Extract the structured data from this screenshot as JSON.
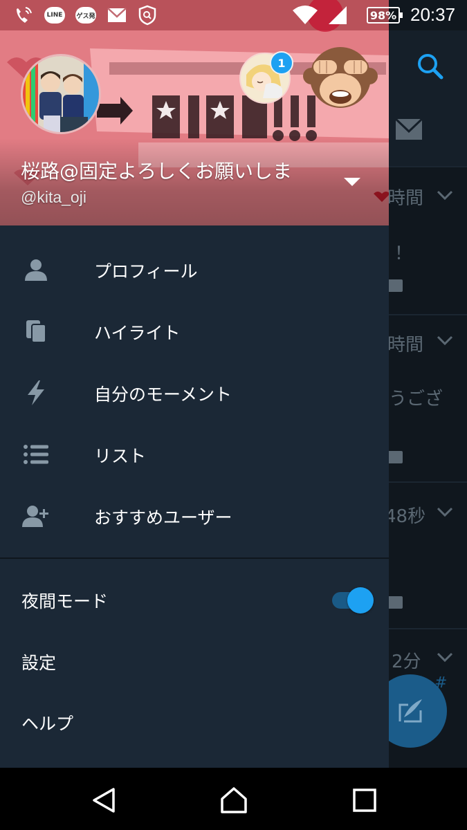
{
  "status_bar": {
    "time": "20:37",
    "battery": "98%",
    "icons": [
      "volte-icon",
      "line-app-icon",
      "chat-app-icon",
      "mail-notification-icon",
      "shield-search-icon",
      "wifi-icon",
      "cell-signal-icon",
      "battery-icon"
    ],
    "line_label": "LINE",
    "chat_label": "ゲス発"
  },
  "drawer": {
    "profile": {
      "display_name": "桜路@固定よろしくお願いしま",
      "username": "@kita_oji",
      "notification_count": "1"
    },
    "menu_items": [
      {
        "label": "プロフィール",
        "icon": "person-icon"
      },
      {
        "label": "ハイライト",
        "icon": "highlights-icon"
      },
      {
        "label": "自分のモーメント",
        "icon": "lightning-icon"
      },
      {
        "label": "リスト",
        "icon": "list-icon"
      },
      {
        "label": "おすすめユーザー",
        "icon": "add-user-icon"
      }
    ],
    "settings": {
      "night_mode_label": "夜間モード",
      "night_mode_on": true,
      "settings_label": "設定",
      "help_label": "ヘルプ"
    }
  },
  "background_timeline": {
    "timestamps": [
      "時間",
      "時間",
      "48秒",
      "2分"
    ],
    "fragments": [
      "！",
      "うござ",
      "#"
    ]
  },
  "nav_bar": {
    "buttons": [
      "back-icon",
      "home-icon",
      "recents-icon"
    ]
  },
  "colors": {
    "accent": "#1da1f2",
    "drawer_bg": "#1b2836",
    "app_bg": "#10171e",
    "muted_text": "#5b6873"
  }
}
